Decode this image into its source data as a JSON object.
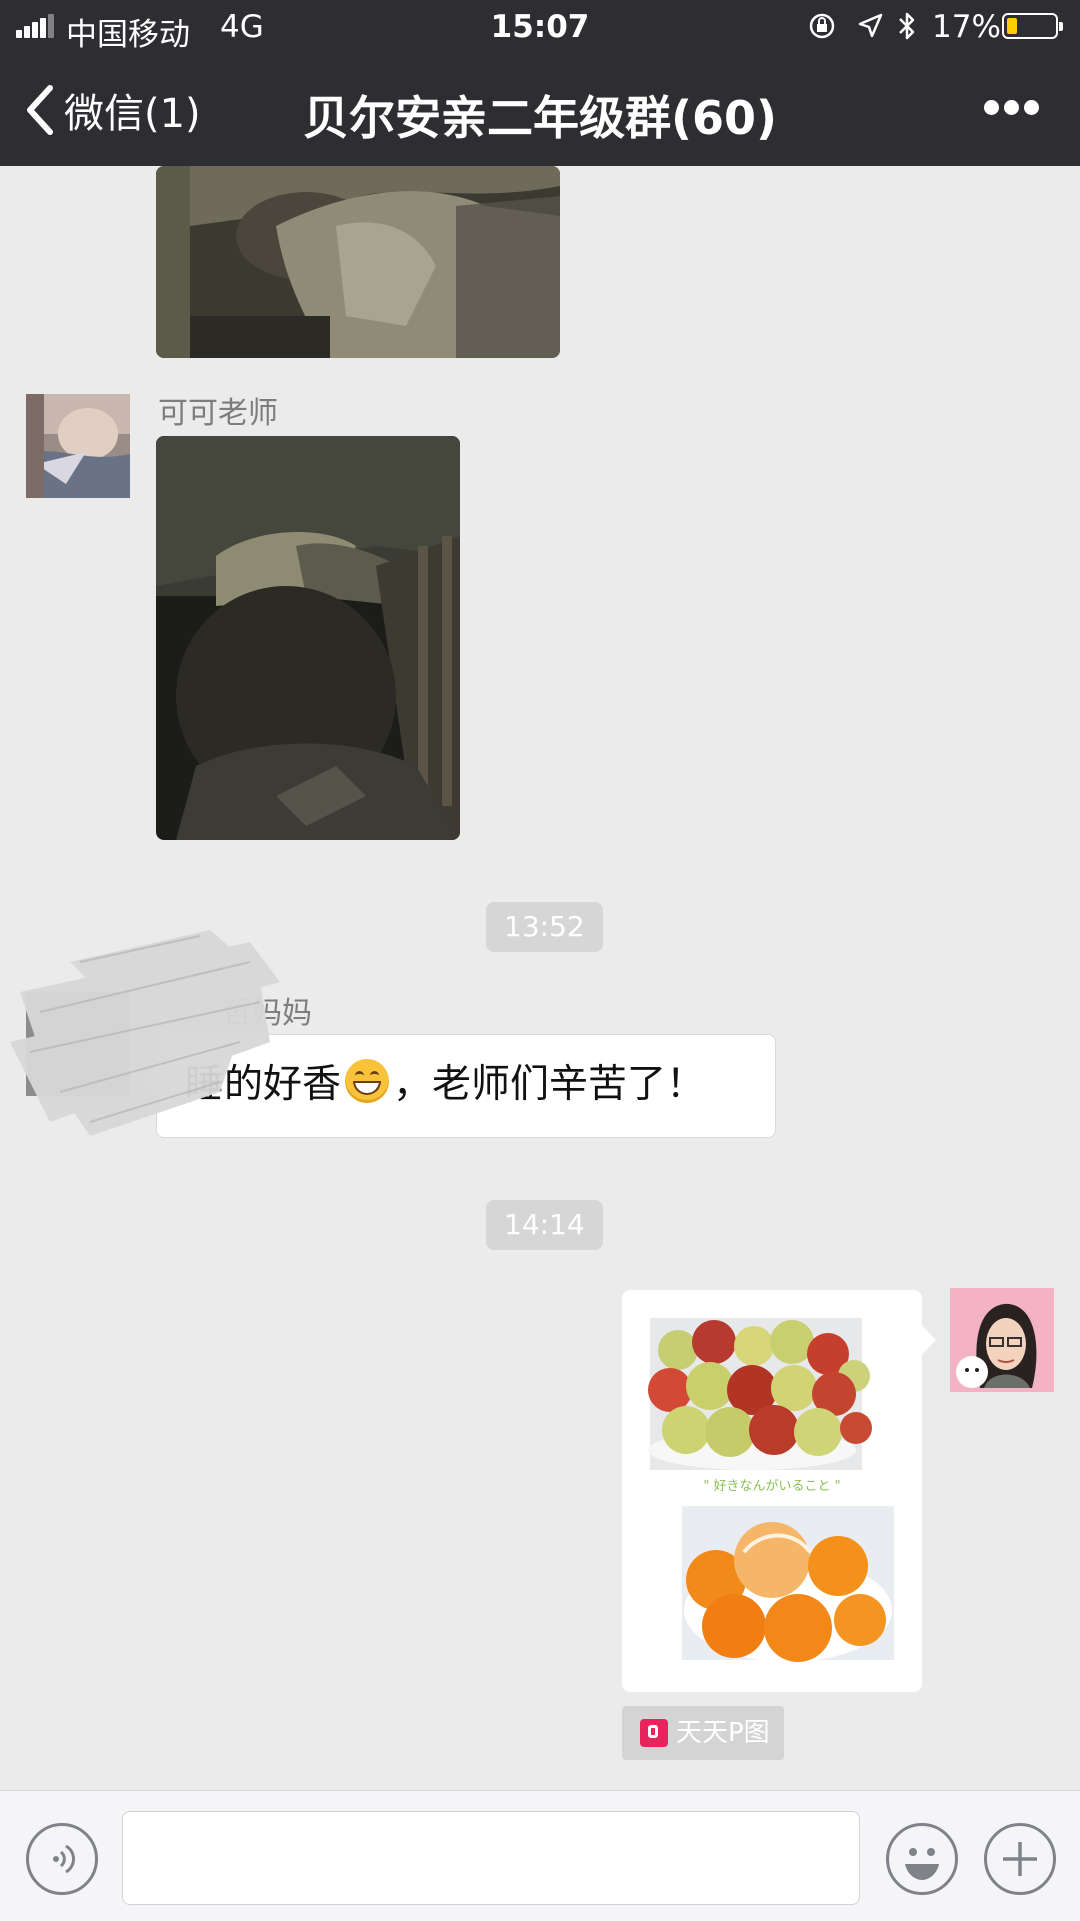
{
  "status_bar": {
    "carrier": "中国移动",
    "network": "4G",
    "time": "15:07",
    "battery_percent": "17%",
    "battery_level": 0.17,
    "icons": [
      "signal-icon",
      "rotation-lock-icon",
      "location-icon",
      "bluetooth-icon",
      "battery-icon"
    ]
  },
  "nav": {
    "back_label": "微信(1)",
    "title": "贝尔安亲二年级群(60)",
    "more_icon": "more-icon"
  },
  "messages": {
    "sender_1": "可可老师",
    "timestamp_1": "13:52",
    "sender_2": "哲妈妈",
    "text_2_part1": "睡的好香",
    "text_2_part2": "，老师们辛苦了！",
    "timestamp_2": "14:14",
    "card_caption": "\" 好きなんがいること \"",
    "source_label": "天天P图"
  },
  "toolbar": {
    "input_value": "",
    "icons": [
      "voice-icon",
      "emoji-icon",
      "plus-icon"
    ]
  },
  "colors": {
    "header_bg": "#2e2e32",
    "chat_bg": "#ebebeb",
    "timestamp_bg": "#d6d6d6",
    "source_logo": "#e8245c",
    "battery_fill": "#ffcc00"
  }
}
